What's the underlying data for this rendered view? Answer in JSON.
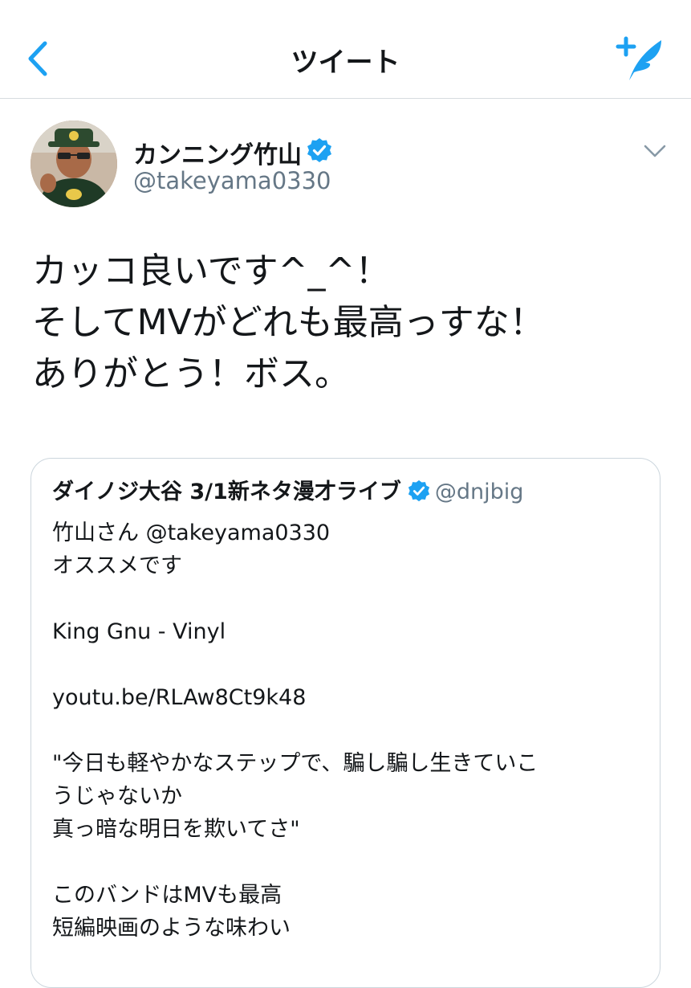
{
  "nav": {
    "title": "ツイート",
    "back_icon": "chevron-left-icon",
    "compose_icon": "compose-tweet-icon",
    "accent_color": "#1da1f2"
  },
  "tweet": {
    "author": {
      "display_name": "カンニング竹山",
      "handle": "@takeyama0330",
      "verified": true
    },
    "text_lines": [
      "カッコ良いです^_^！",
      "そしてMVがどれも最高っすな！",
      "ありがとう！ボス。"
    ]
  },
  "quoted_tweet": {
    "display_name": "ダイノジ大谷 3/1新ネタ漫才ライブ",
    "handle": "@dnjbig",
    "verified": true,
    "lines": [
      "竹山さん @takeyama0330",
      "オススメです",
      "",
      "King Gnu - Vinyl",
      "",
      "youtu.be/RLAw8Ct9k48",
      "",
      "\"今日も軽やかなステップで、騙し騙し生きていこ",
      "うじゃないか",
      "真っ暗な明日を欺いてさ\"",
      "",
      "このバンドはMVも最高",
      "短編映画のような味わい"
    ]
  }
}
